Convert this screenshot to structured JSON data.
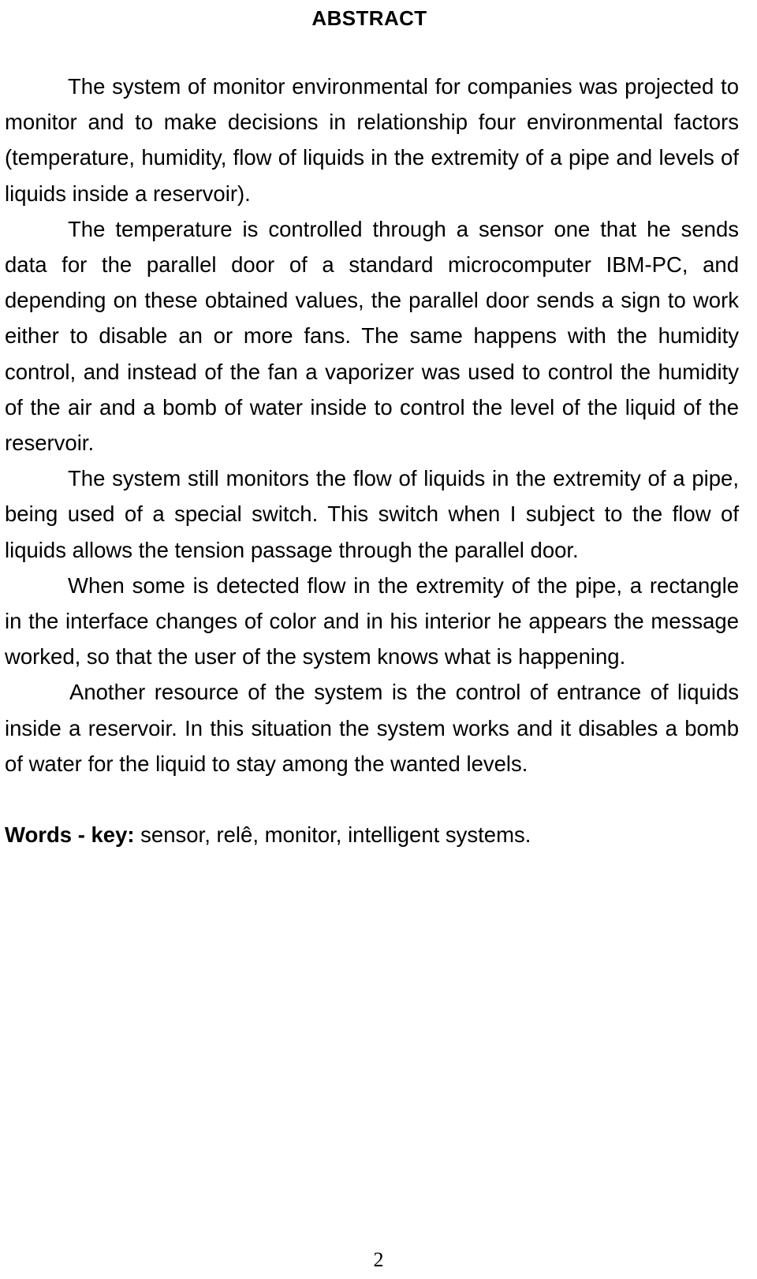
{
  "document": {
    "heading": "ABSTRACT",
    "paragraphs": [
      "The system of monitor environmental for companies was projected to monitor and to make decisions in relationship four environmental factors (temperature, humidity, flow of liquids in the extremity of a pipe and levels of liquids inside a reservoir).",
      "The temperature is controlled through a sensor one that he sends data for the parallel door of a standard microcomputer IBM-PC, and depending on these obtained values, the parallel door sends a sign to work either to disable an or more fans. The same happens with the humidity control, and instead of the fan a vaporizer was used to control the humidity of the air and a bomb of water inside to control the level of the liquid of the reservoir.",
      "The system still monitors the flow of liquids in the extremity of a pipe, being used of a special switch. This switch when I subject to the flow of liquids allows the tension passage through the parallel door.",
      "When some is detected flow in the extremity of the pipe, a rectangle in the interface changes of color and in his interior he appears the message worked, so that the user of the system knows what is happening.",
      "Another resource of the system is the control of entrance of liquids inside a reservoir. In this situation the system works and it disables a bomb of water for the liquid to stay among the wanted levels."
    ],
    "keywords": {
      "label": "Words - key:",
      "value": " sensor, relê, monitor, intelligent systems."
    },
    "page_number": "2"
  }
}
